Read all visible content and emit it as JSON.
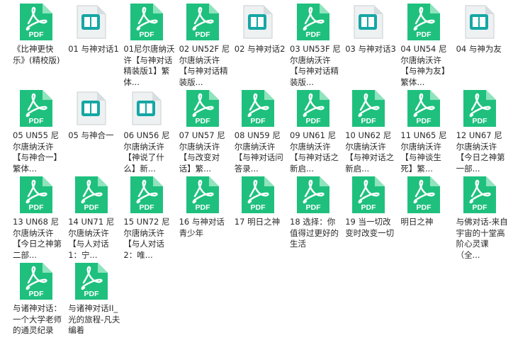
{
  "colors": {
    "pdf_green": "#1fc07e",
    "pdf_fold": "#8fe3bd",
    "book_teal": "#15a7a4",
    "book_paper": "#eef1f2"
  },
  "files": [
    {
      "type": "pdf-icon",
      "name": "《比神更快乐》(精校版)"
    },
    {
      "type": "book-icon",
      "name": "01 与神对话1"
    },
    {
      "type": "pdf-icon",
      "name": "01尼尔唐纳沃许【与神对话精装版1】繁体..."
    },
    {
      "type": "pdf-icon",
      "name": "02 UN52F 尼尔唐纳沃许【与神对话精装版..."
    },
    {
      "type": "book-icon",
      "name": "02 与神对话2"
    },
    {
      "type": "pdf-icon",
      "name": "03 UN53F 尼尔唐纳沃许【与神对话精装版..."
    },
    {
      "type": "book-icon",
      "name": "03 与神对话3"
    },
    {
      "type": "pdf-icon",
      "name": "04 UN54 尼尔唐纳沃许【与神为友】繁体..."
    },
    {
      "type": "book-icon",
      "name": "04 与神为友"
    },
    {
      "type": "pdf-icon",
      "name": "05 UN55 尼尔唐纳沃许【与神合一】繁体..."
    },
    {
      "type": "book-icon",
      "name": "05 与神合一"
    },
    {
      "type": "book-icon",
      "name": "06 UN56 尼尔唐纳沃许【神说了什么】新..."
    },
    {
      "type": "pdf-icon",
      "name": "07 UN57 尼尔唐纳沃许【与改变对话】繁..."
    },
    {
      "type": "pdf-icon",
      "name": "08 UN59 尼尔唐纳沃许【与神对话问答录..."
    },
    {
      "type": "pdf-icon",
      "name": "09 UN61 尼尔唐纳沃许【与神对话之新启..."
    },
    {
      "type": "pdf-icon",
      "name": "10 UN62 尼尔唐纳沃许【与神对话之新启..."
    },
    {
      "type": "pdf-icon",
      "name": "11 UN65 尼尔唐纳沃许【与神谈生死】繁..."
    },
    {
      "type": "pdf-icon",
      "name": "12 UN67 尼尔唐纳沃许【今日之神第一部..."
    },
    {
      "type": "pdf-icon",
      "name": "13 UN68 尼尔唐纳沃许【今日之神第二部..."
    },
    {
      "type": "pdf-icon",
      "name": "14 UN71 尼尔唐纳沃许【与人对话1：宁..."
    },
    {
      "type": "pdf-icon",
      "name": "15 UN72 尼尔唐纳沃许【与人对话2：唯..."
    },
    {
      "type": "pdf-icon",
      "name": "16 与神对话青少年"
    },
    {
      "type": "pdf-icon",
      "name": "17 明日之神"
    },
    {
      "type": "pdf-icon",
      "name": "18 选择：你值得过更好的生活"
    },
    {
      "type": "pdf-icon",
      "name": "19 当一切改变时改变一切"
    },
    {
      "type": "pdf-icon",
      "name": "明日之神"
    },
    {
      "type": "pdf-icon",
      "name": "与佛对话-来自宇宙的十堂高阶心灵课（全..."
    },
    {
      "type": "pdf-icon",
      "name": "与诸神对话：一个大学老师的通灵纪录"
    },
    {
      "type": "pdf-icon",
      "name": "与诸神对话II_光的旅程-凡夫编着"
    }
  ]
}
